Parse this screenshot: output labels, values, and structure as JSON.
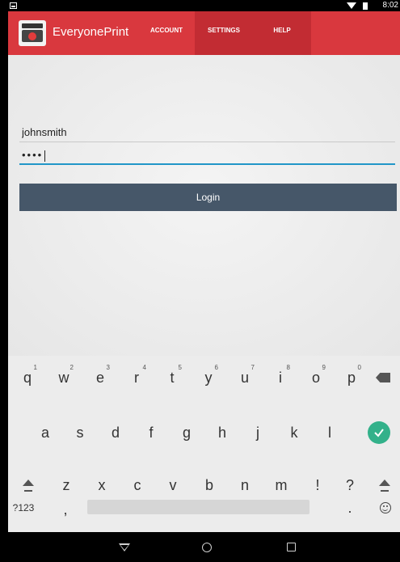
{
  "status_bar": {
    "time": "8:02"
  },
  "app": {
    "title": "EveryonePrint"
  },
  "tabs": [
    {
      "label": "ACCOUNT"
    },
    {
      "label": "SETTINGS"
    },
    {
      "label": "HELP"
    }
  ],
  "login": {
    "username_value": "johnsmith",
    "password_masked": "••••",
    "button_label": "Login"
  },
  "keyboard": {
    "row1": [
      {
        "key": "q",
        "hint": "1"
      },
      {
        "key": "w",
        "hint": "2"
      },
      {
        "key": "e",
        "hint": "3"
      },
      {
        "key": "r",
        "hint": "4"
      },
      {
        "key": "t",
        "hint": "5"
      },
      {
        "key": "y",
        "hint": "6"
      },
      {
        "key": "u",
        "hint": "7"
      },
      {
        "key": "i",
        "hint": "8"
      },
      {
        "key": "o",
        "hint": "9"
      },
      {
        "key": "p",
        "hint": "0"
      }
    ],
    "row2": [
      "a",
      "s",
      "d",
      "f",
      "g",
      "h",
      "j",
      "k",
      "l"
    ],
    "row3": [
      "z",
      "x",
      "c",
      "v",
      "b",
      "n",
      "m",
      "!",
      "?"
    ],
    "row4": {
      "symbols": "?123",
      "comma": ",",
      "period": "."
    },
    "icons": {
      "backspace": "backspace-icon",
      "enter": "checkmark-icon",
      "shift": "shift-icon",
      "emoji": "smiley-icon"
    },
    "enter_color": "#33b18a"
  },
  "colors": {
    "action_bar": "#d9383e",
    "active_tab": "#c22c33",
    "login_button": "#465769",
    "focus_underline": "#2196c8"
  }
}
